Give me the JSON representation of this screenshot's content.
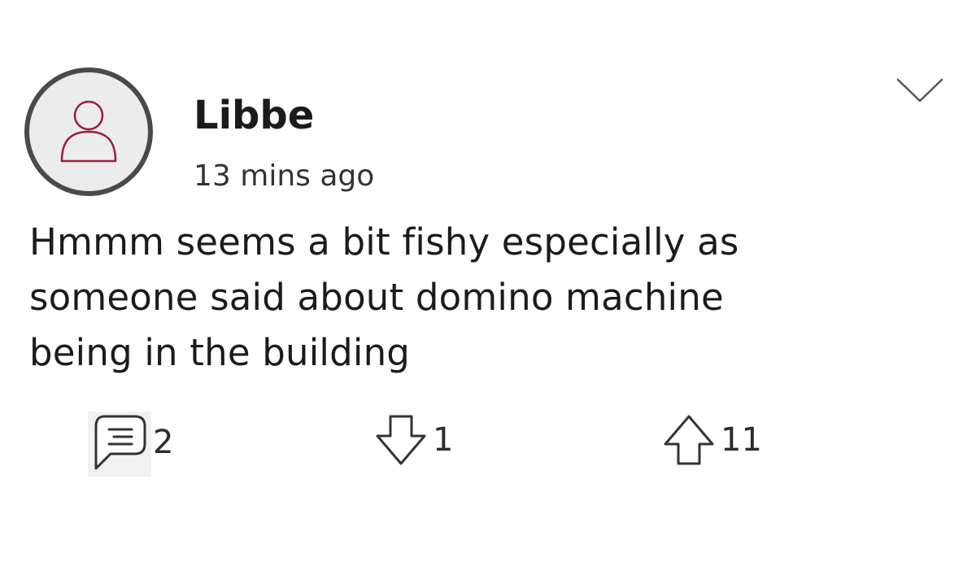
{
  "post": {
    "author": "Libbe",
    "time_ago": "13 mins ago",
    "lines": [
      "Hmmm seems a bit fishy especially as",
      "someone said about domino machine",
      "being in the building"
    ]
  },
  "actions": {
    "comments": {
      "icon": "comment-icon",
      "count": "2"
    },
    "downvotes": {
      "icon": "arrow-down-icon",
      "count": "1"
    },
    "upvotes": {
      "icon": "arrow-up-icon",
      "count": "11"
    }
  },
  "menu": {
    "icon": "chevron-down-icon"
  },
  "avatar": {
    "icon": "user-icon",
    "accent": "#9c1c3c"
  }
}
